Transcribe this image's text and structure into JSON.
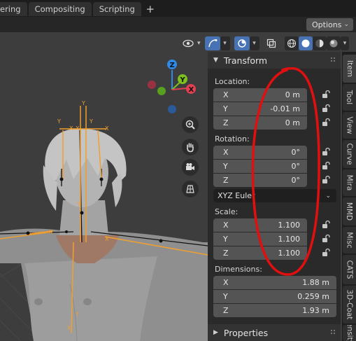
{
  "workspace_tabs": [
    "ering",
    "Compositing",
    "Scripting"
  ],
  "add_tab_label": "+",
  "options_label": "Options",
  "transform": {
    "title": "Transform",
    "location_label": "Location:",
    "location": [
      {
        "axis": "X",
        "value": "0 m"
      },
      {
        "axis": "Y",
        "value": "-0.01 m"
      },
      {
        "axis": "Z",
        "value": "0 m"
      }
    ],
    "rotation_label": "Rotation:",
    "rotation": [
      {
        "axis": "X",
        "value": "0°"
      },
      {
        "axis": "Y",
        "value": "0°"
      },
      {
        "axis": "Z",
        "value": "0°"
      }
    ],
    "rotation_mode": "XYZ Euler",
    "scale_label": "Scale:",
    "scale": [
      {
        "axis": "X",
        "value": "1.100"
      },
      {
        "axis": "Y",
        "value": "1.100"
      },
      {
        "axis": "Z",
        "value": "1.100"
      }
    ],
    "dimensions_label": "Dimensions:",
    "dimensions": [
      {
        "axis": "X",
        "value": "1.88 m"
      },
      {
        "axis": "Y",
        "value": "0.259 m"
      },
      {
        "axis": "Z",
        "value": "1.93 m"
      }
    ]
  },
  "properties_title": "Properties",
  "side_tabs": [
    "Item",
    "Tool",
    "View",
    "Curve",
    "Mira",
    "MMD",
    "Misc",
    "CATS",
    "3D-Coat",
    "ensity"
  ],
  "gizmo": {
    "z": "Z",
    "y": "Y",
    "x": "X"
  },
  "bone_labels": [
    "Y",
    "X",
    "Y",
    "X",
    "Y",
    "X",
    "Y",
    "X",
    "X",
    "X",
    "Y"
  ],
  "colors": {
    "accent": "#4772b3",
    "bone": "#f0a030",
    "annotation": "#e01010",
    "axis_x": "#e0404f",
    "axis_y": "#7ec020",
    "axis_z": "#2e8ae6"
  }
}
